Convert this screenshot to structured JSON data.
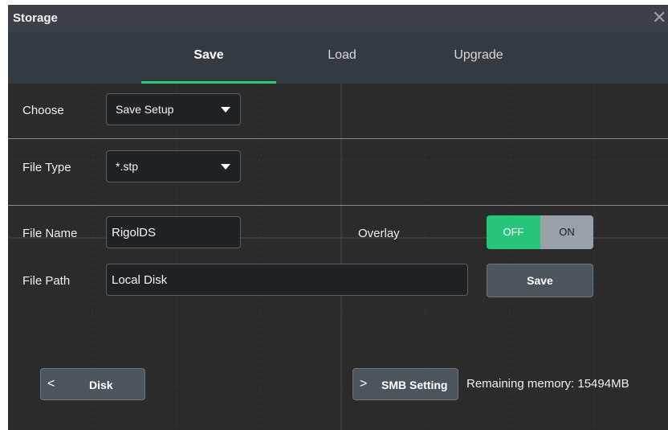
{
  "window": {
    "title": "Storage",
    "close_icon": "close-icon"
  },
  "tabs": [
    {
      "label": "Save",
      "active": true
    },
    {
      "label": "Load",
      "active": false
    },
    {
      "label": "Upgrade",
      "active": false
    }
  ],
  "form": {
    "choose": {
      "label": "Choose",
      "value": "Save Setup"
    },
    "file_type": {
      "label": "File Type",
      "value": "*.stp"
    },
    "file_name": {
      "label": "File Name",
      "value": "RigolDS"
    },
    "overlay": {
      "label": "Overlay",
      "off_label": "OFF",
      "on_label": "ON",
      "selected": "OFF"
    },
    "file_path": {
      "label": "File Path",
      "value": "Local Disk"
    },
    "save_button": "Save"
  },
  "footer": {
    "disk_button": "Disk",
    "smb_button": "SMB Setting",
    "remaining_memory": "Remaining memory: 15494MB"
  },
  "colors": {
    "accent": "#2ecc71",
    "toggle_off_active": "#27c57a"
  }
}
